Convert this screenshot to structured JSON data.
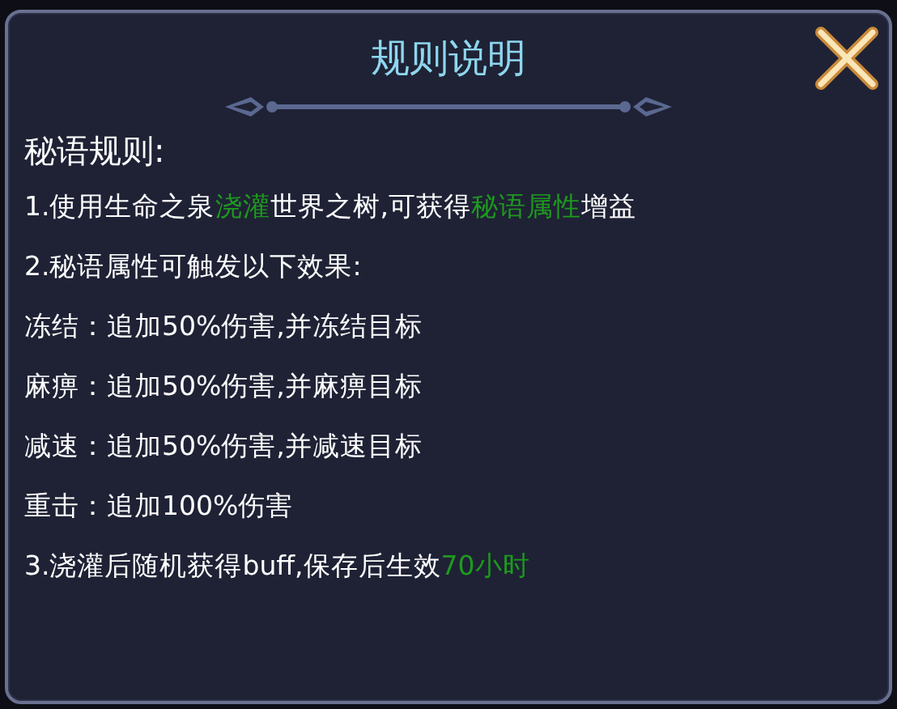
{
  "title": "规则说明",
  "heading": "秘语规则:",
  "lines": [
    {
      "segments": [
        {
          "text": "1.使用生命之泉",
          "highlight": false
        },
        {
          "text": "浇灌",
          "highlight": true
        },
        {
          "text": "世界之树,可获得",
          "highlight": false
        },
        {
          "text": "秘语属性",
          "highlight": true
        },
        {
          "text": "增益",
          "highlight": false
        }
      ]
    },
    {
      "segments": [
        {
          "text": "2.秘语属性可触发以下效果:",
          "highlight": false
        }
      ]
    },
    {
      "segments": [
        {
          "text": "冻结：追加50%伤害,并冻结目标",
          "highlight": false
        }
      ]
    },
    {
      "segments": [
        {
          "text": "麻痹：追加50%伤害,并麻痹目标",
          "highlight": false
        }
      ]
    },
    {
      "segments": [
        {
          "text": "减速：追加50%伤害,并减速目标",
          "highlight": false
        }
      ]
    },
    {
      "segments": [
        {
          "text": "重击：追加100%伤害",
          "highlight": false
        }
      ]
    },
    {
      "segments": [
        {
          "text": "3.浇灌后随机获得buff,保存后生效",
          "highlight": false
        },
        {
          "text": "70小时",
          "highlight": true
        }
      ]
    }
  ]
}
